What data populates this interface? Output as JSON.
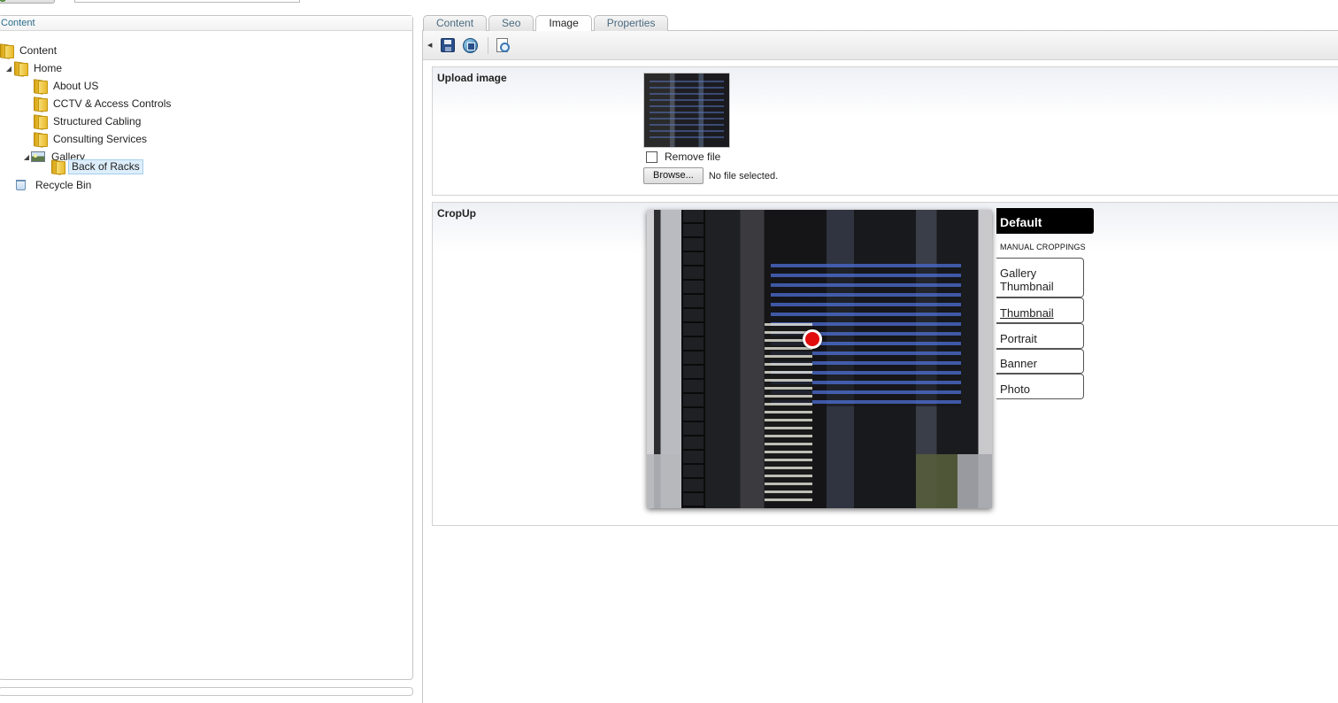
{
  "left_panel": {
    "header": "Content",
    "tree": [
      {
        "label": "Content"
      },
      {
        "label": "Home"
      },
      {
        "label": "About US"
      },
      {
        "label": "CCTV & Access Controls"
      },
      {
        "label": "Structured Cabling"
      },
      {
        "label": "Consulting Services"
      },
      {
        "label": "Gallery"
      },
      {
        "label": "Back of Racks",
        "selected": true
      },
      {
        "label": "Recycle Bin"
      }
    ]
  },
  "tabs": [
    {
      "label": "Content"
    },
    {
      "label": "Seo"
    },
    {
      "label": "Image",
      "active": true
    },
    {
      "label": "Properties"
    }
  ],
  "upload": {
    "label": "Upload image",
    "remove_label": "Remove file",
    "browse_label": "Browse...",
    "file_status": "No file selected."
  },
  "cropup": {
    "label": "CropUp",
    "default_label": "Default",
    "heading": "MANUAL CROPPINGS",
    "items": [
      {
        "label": "Gallery Thumbnail"
      },
      {
        "label": "Thumbnail"
      },
      {
        "label": "Portrait"
      },
      {
        "label": "Banner"
      },
      {
        "label": "Photo"
      }
    ]
  },
  "colors": {
    "focal_point": "#e10d0d",
    "selected_bg": "#ddeefb",
    "header_text": "#2a6a8a"
  }
}
